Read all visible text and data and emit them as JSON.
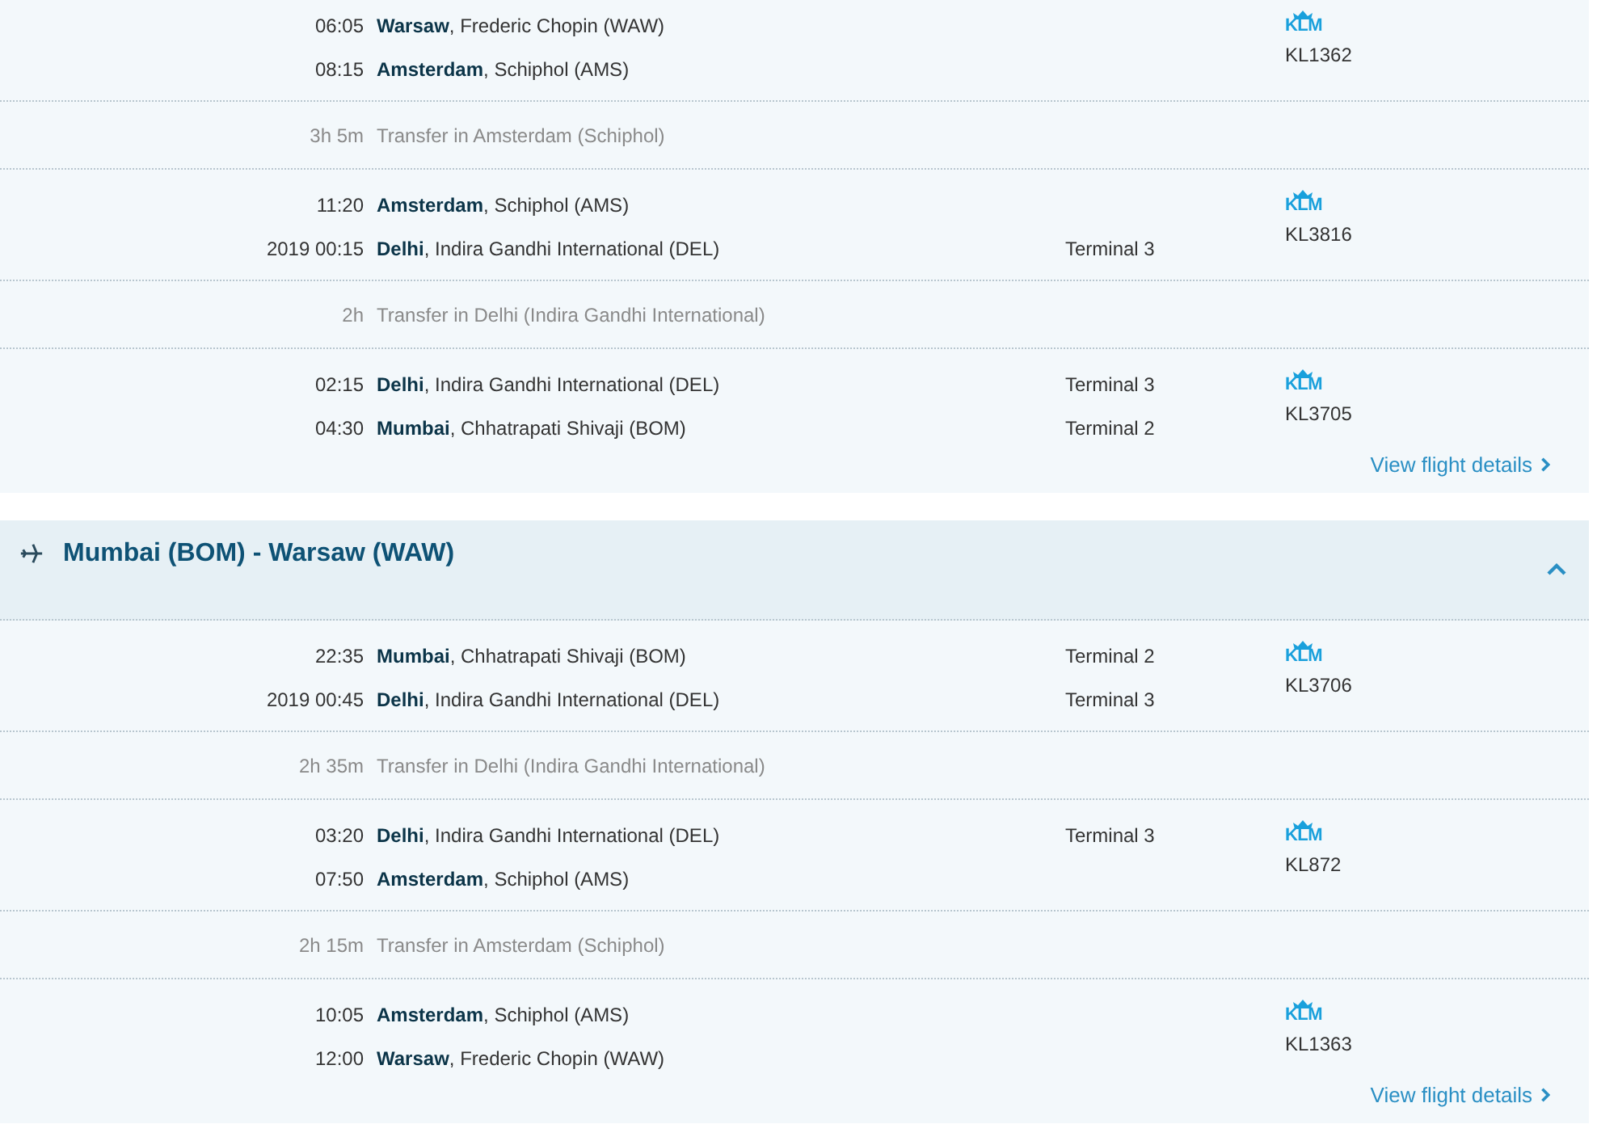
{
  "sections": [
    {
      "items": [
        {
          "kind": "segment",
          "legs": [
            {
              "time": "06:05",
              "city": "Warsaw",
              "airport": ", Frederic Chopin (WAW)"
            },
            {
              "time": "08:15",
              "city": "Amsterdam",
              "airport": ", Schiphol (AMS)"
            }
          ],
          "airline": "KLM",
          "flight": "KL1362"
        },
        {
          "kind": "transfer",
          "duration": "3h 5m",
          "text": "Transfer in Amsterdam (Schiphol)"
        },
        {
          "kind": "segment",
          "legs": [
            {
              "time": "11:20",
              "city": "Amsterdam",
              "airport": ", Schiphol (AMS)"
            },
            {
              "time": "2019 00:15",
              "city": "Delhi",
              "airport": ", Indira Gandhi International (DEL)",
              "terminal": "Terminal 3"
            }
          ],
          "airline": "KLM",
          "flight": "KL3816"
        },
        {
          "kind": "transfer",
          "duration": "2h",
          "text": "Transfer in Delhi (Indira Gandhi International)"
        },
        {
          "kind": "segment",
          "legs": [
            {
              "time": "02:15",
              "city": "Delhi",
              "airport": ", Indira Gandhi International (DEL)",
              "terminal": "Terminal 3"
            },
            {
              "time": "04:30",
              "city": "Mumbai",
              "airport": ", Chhatrapati Shivaji (BOM)",
              "terminal": "Terminal 2"
            }
          ],
          "airline": "KLM",
          "flight": "KL3705"
        }
      ],
      "link": "View flight details"
    },
    {
      "header": {
        "title": "Mumbai (BOM) - Warsaw (WAW)",
        "expanded": true
      },
      "items": [
        {
          "kind": "segment",
          "legs": [
            {
              "time": "22:35",
              "city": "Mumbai",
              "airport": ", Chhatrapati Shivaji (BOM)",
              "terminal": "Terminal 2"
            },
            {
              "time": "2019 00:45",
              "city": "Delhi",
              "airport": ", Indira Gandhi International (DEL)",
              "terminal": "Terminal 3"
            }
          ],
          "airline": "KLM",
          "flight": "KL3706"
        },
        {
          "kind": "transfer",
          "duration": "2h 35m",
          "text": "Transfer in Delhi (Indira Gandhi International)"
        },
        {
          "kind": "segment",
          "legs": [
            {
              "time": "03:20",
              "city": "Delhi",
              "airport": ", Indira Gandhi International (DEL)",
              "terminal": "Terminal 3"
            },
            {
              "time": "07:50",
              "city": "Amsterdam",
              "airport": ", Schiphol (AMS)"
            }
          ],
          "airline": "KLM",
          "flight": "KL872"
        },
        {
          "kind": "transfer",
          "duration": "2h 15m",
          "text": "Transfer in Amsterdam (Schiphol)"
        },
        {
          "kind": "segment",
          "legs": [
            {
              "time": "10:05",
              "city": "Amsterdam",
              "airport": ", Schiphol (AMS)"
            },
            {
              "time": "12:00",
              "city": "Warsaw",
              "airport": ", Frederic Chopin (WAW)"
            }
          ],
          "airline": "KLM",
          "flight": "KL1363"
        }
      ],
      "link": "View flight details"
    }
  ]
}
